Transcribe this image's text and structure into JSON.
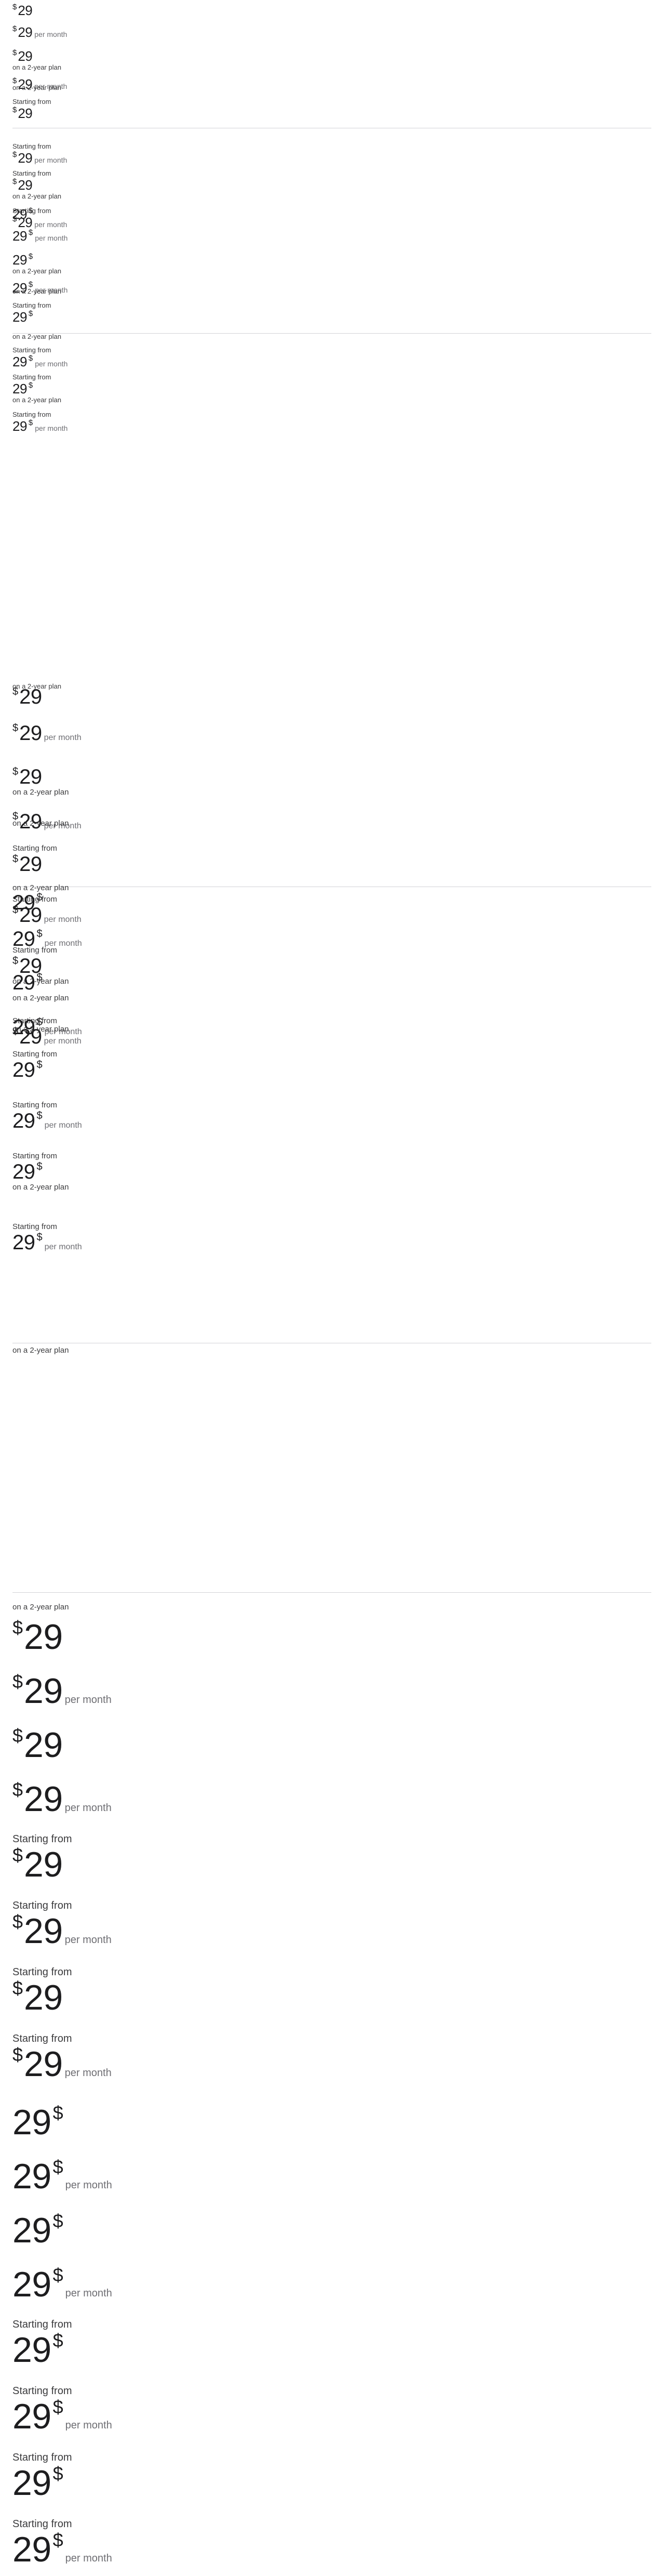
{
  "currency_symbol": "$",
  "price": "29",
  "period_label": "per month",
  "plan_caption": "on a 2-year plan",
  "starting_label": "Starting from",
  "colors": {
    "text": "#1d1d1f",
    "muted": "#6e6e73",
    "divider": "#d2d2d7"
  },
  "price_display_variants": [
    {
      "size": "small",
      "currency_position": "before"
    },
    {
      "size": "small",
      "currency_position": "after"
    },
    {
      "size": "medium",
      "currency_position": "before"
    },
    {
      "size": "medium",
      "currency_position": "after"
    },
    {
      "size": "large",
      "currency_position": "before"
    },
    {
      "size": "large",
      "currency_position": "after"
    }
  ]
}
